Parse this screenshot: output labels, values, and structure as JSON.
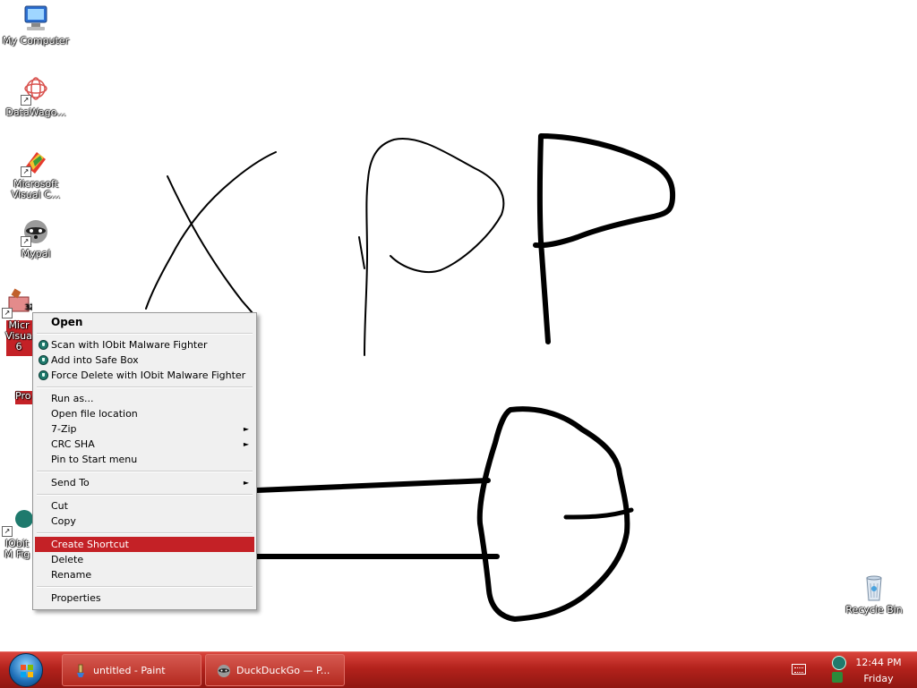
{
  "desktop_icons": {
    "my_computer": "My Computer",
    "datawago": "DataWago...",
    "visual_c": "Microsoft Visual C...",
    "mypal": "Mypal",
    "selected_partial": "Micr Visua 6",
    "pro_partial": "Pro",
    "iobit_partial": "IObit M Fig",
    "recycle_bin": "Recycle Bin"
  },
  "context_menu": {
    "open": "Open",
    "scan_iobit": "Scan with IObit Malware Fighter",
    "add_safe_box": "Add into Safe Box",
    "force_delete": "Force Delete with IObit Malware Fighter",
    "run_as": "Run as...",
    "open_file_location": "Open file location",
    "seven_zip": "7-Zip",
    "crc_sha": "CRC SHA",
    "pin_start": "Pin to Start menu",
    "send_to": "Send To",
    "cut": "Cut",
    "copy": "Copy",
    "create_shortcut": "Create Shortcut",
    "delete": "Delete",
    "rename": "Rename",
    "properties": "Properties"
  },
  "taskbar": {
    "task1": "untitled - Paint",
    "task2": "DuckDuckGo — P...",
    "clock_time": "12:44 PM",
    "clock_day": "Friday"
  },
  "colors": {
    "taskbar": "#b3221c",
    "highlight": "#c42126",
    "menu_bg": "#f0f0f0"
  }
}
